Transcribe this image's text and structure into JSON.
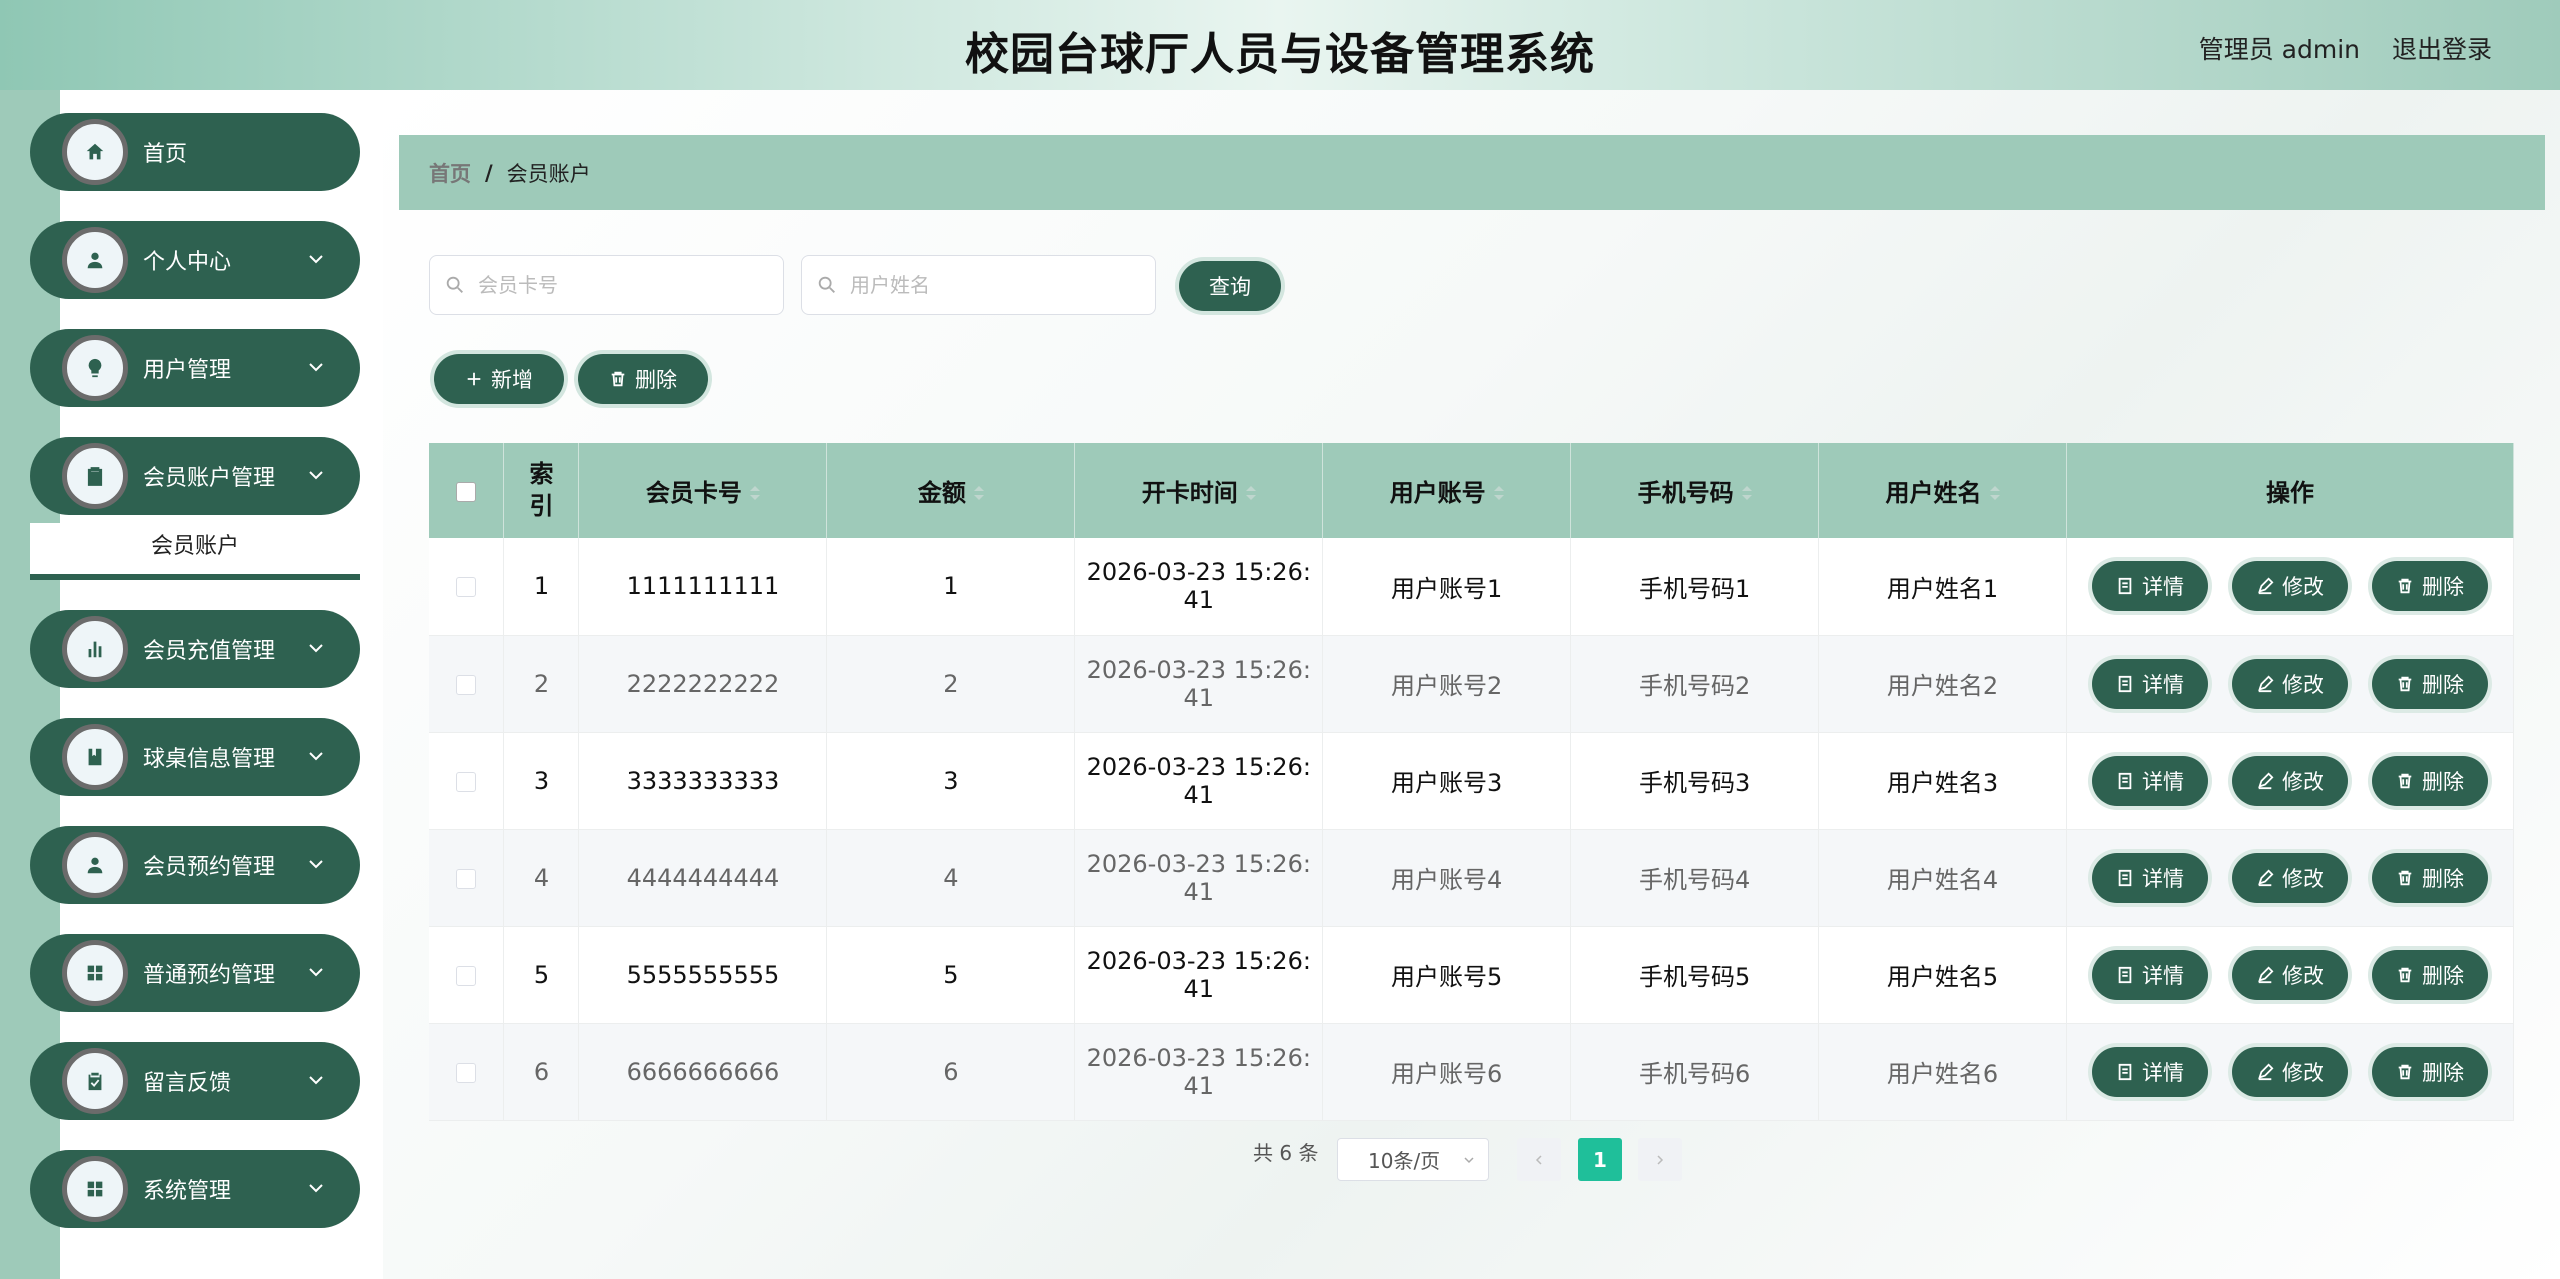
{
  "header": {
    "title": "校园台球厅人员与设备管理系统",
    "admin_label": "管理员 admin",
    "logout_label": "退出登录"
  },
  "sidebar": {
    "items": [
      {
        "label": "首页",
        "icon": "home-icon",
        "has_arrow": false
      },
      {
        "label": "个人中心",
        "icon": "user-icon",
        "has_arrow": true
      },
      {
        "label": "用户管理",
        "icon": "bulb-icon",
        "has_arrow": true
      },
      {
        "label": "会员账户管理",
        "icon": "clipboard-icon",
        "has_arrow": true
      },
      {
        "label": "会员充值管理",
        "icon": "bar-chart-icon",
        "has_arrow": true
      },
      {
        "label": "球桌信息管理",
        "icon": "book-icon",
        "has_arrow": true
      },
      {
        "label": "会员预约管理",
        "icon": "user-icon",
        "has_arrow": true
      },
      {
        "label": "普通预约管理",
        "icon": "grid-icon",
        "has_arrow": true
      },
      {
        "label": "留言反馈",
        "icon": "clipboard-check-icon",
        "has_arrow": true
      },
      {
        "label": "系统管理",
        "icon": "grid-icon",
        "has_arrow": true
      }
    ],
    "submenu_label": "会员账户"
  },
  "breadcrumb": {
    "home": "首页",
    "separator": "/",
    "current": "会员账户"
  },
  "search": {
    "card_placeholder": "会员卡号",
    "name_placeholder": "用户姓名",
    "query_label": "查询"
  },
  "actions": {
    "add_label": "新增",
    "delete_label": "删除"
  },
  "table": {
    "headers": [
      "索引",
      "会员卡号",
      "金额",
      "开卡时间",
      "用户账号",
      "手机号码",
      "用户姓名",
      "操作"
    ],
    "rows": [
      {
        "index": "1",
        "card": "1111111111",
        "amount": "1",
        "time1": "2026-03-23 15:26:",
        "time2": "41",
        "account": "用户账号1",
        "phone": "手机号码1",
        "name": "用户姓名1"
      },
      {
        "index": "2",
        "card": "2222222222",
        "amount": "2",
        "time1": "2026-03-23 15:26:",
        "time2": "41",
        "account": "用户账号2",
        "phone": "手机号码2",
        "name": "用户姓名2"
      },
      {
        "index": "3",
        "card": "3333333333",
        "amount": "3",
        "time1": "2026-03-23 15:26:",
        "time2": "41",
        "account": "用户账号3",
        "phone": "手机号码3",
        "name": "用户姓名3"
      },
      {
        "index": "4",
        "card": "4444444444",
        "amount": "4",
        "time1": "2026-03-23 15:26:",
        "time2": "41",
        "account": "用户账号4",
        "phone": "手机号码4",
        "name": "用户姓名4"
      },
      {
        "index": "5",
        "card": "5555555555",
        "amount": "5",
        "time1": "2026-03-23 15:26:",
        "time2": "41",
        "account": "用户账号5",
        "phone": "手机号码5",
        "name": "用户姓名5"
      },
      {
        "index": "6",
        "card": "6666666666",
        "amount": "6",
        "time1": "2026-03-23 15:26:",
        "time2": "41",
        "account": "用户账号6",
        "phone": "手机号码6",
        "name": "用户姓名6"
      }
    ],
    "op_detail": "详情",
    "op_edit": "修改",
    "op_delete": "删除"
  },
  "pagination": {
    "total": "共 6 条",
    "page_size": "10条/页",
    "current_page": "1"
  },
  "colors": {
    "primary": "#2e6150",
    "accent": "#9ecab9",
    "active_page": "#1fbf9a"
  }
}
